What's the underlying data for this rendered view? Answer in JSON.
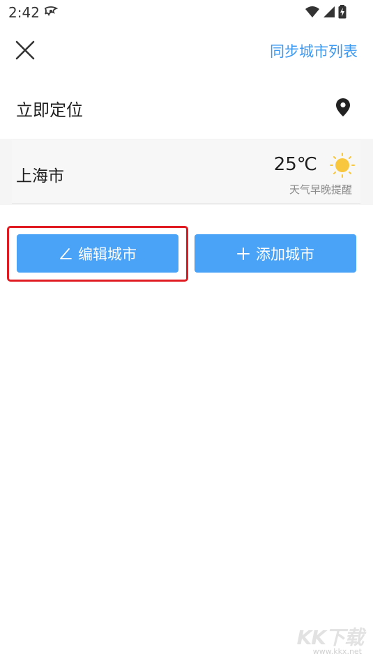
{
  "status_bar": {
    "time": "2:42",
    "icons": [
      "app-notification-icon",
      "wifi-icon",
      "cellular-signal-icon",
      "battery-charging-icon"
    ]
  },
  "header": {
    "close_icon": "close-icon",
    "sync_label": "同步城市列表"
  },
  "locate": {
    "label": "立即定位",
    "icon": "location-pin-icon"
  },
  "cities": [
    {
      "name": "上海市",
      "temperature": "25℃",
      "weather_icon": "sunny-icon",
      "remind": "天气早晚提醒"
    }
  ],
  "actions": {
    "edit_label": "编辑城市",
    "edit_icon": "edit-icon",
    "add_label": "添加城市",
    "add_icon": "plus-icon"
  },
  "watermark": {
    "text": "KK下载",
    "url": "www.kkx.net"
  },
  "colors": {
    "accent": "#4aa3f7",
    "link": "#3d9af2",
    "highlight": "#e01c22",
    "sun": "#f9c73d"
  }
}
